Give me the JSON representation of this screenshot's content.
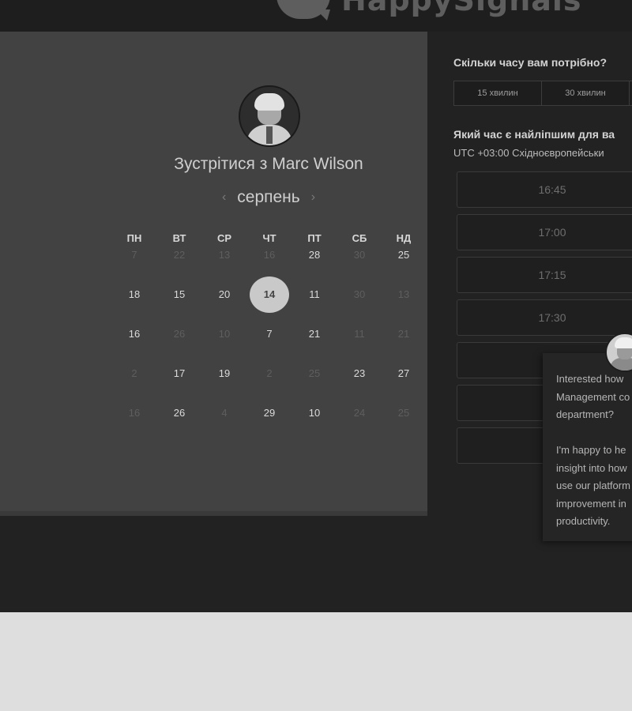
{
  "header": {
    "logo_text": "HappySignals"
  },
  "scheduler": {
    "title": "Зустрітися з Marc Wilson",
    "month": "серпень",
    "prev_label": "‹",
    "next_label": "›",
    "weekdays": [
      "ПН",
      "ВТ",
      "СР",
      "ЧТ",
      "ПТ",
      "СБ",
      "НД"
    ],
    "weeks": [
      [
        {
          "d": "7",
          "a": false
        },
        {
          "d": "22",
          "a": false
        },
        {
          "d": "13",
          "a": false
        },
        {
          "d": "16",
          "a": false
        },
        {
          "d": "28",
          "a": true
        },
        {
          "d": "30",
          "a": false
        },
        {
          "d": "25",
          "a": true
        }
      ],
      [
        {
          "d": "18",
          "a": true
        },
        {
          "d": "15",
          "a": true
        },
        {
          "d": "20",
          "a": true
        },
        {
          "d": "14",
          "a": true,
          "selected": true
        },
        {
          "d": "11",
          "a": true
        },
        {
          "d": "30",
          "a": false
        },
        {
          "d": "13",
          "a": false
        }
      ],
      [
        {
          "d": "16",
          "a": true
        },
        {
          "d": "26",
          "a": false
        },
        {
          "d": "10",
          "a": false
        },
        {
          "d": "7",
          "a": true
        },
        {
          "d": "21",
          "a": true
        },
        {
          "d": "11",
          "a": false
        },
        {
          "d": "21",
          "a": false
        }
      ],
      [
        {
          "d": "2",
          "a": false
        },
        {
          "d": "17",
          "a": true
        },
        {
          "d": "19",
          "a": true
        },
        {
          "d": "2",
          "a": false
        },
        {
          "d": "25",
          "a": false
        },
        {
          "d": "23",
          "a": true
        },
        {
          "d": "27",
          "a": true
        }
      ],
      [
        {
          "d": "16",
          "a": false
        },
        {
          "d": "26",
          "a": true
        },
        {
          "d": "4",
          "a": false
        },
        {
          "d": "29",
          "a": true
        },
        {
          "d": "10",
          "a": true
        },
        {
          "d": "24",
          "a": false
        },
        {
          "d": "25",
          "a": false
        }
      ]
    ]
  },
  "booking": {
    "duration_question": "Скільки часу вам потрібно?",
    "durations": [
      "15 хвилин",
      "30 хвилин"
    ],
    "time_question": "Який час є найліпшим для ва",
    "timezone": "UTC +03:00 Східноєвропейськи",
    "slots": [
      "16:45",
      "17:00",
      "17:15",
      "17:30",
      "",
      "",
      ""
    ]
  },
  "chat": {
    "message": "Interested how\nManagement co\ndepartment?\n\nI'm happy to he\ninsight into how\nuse our platform\nimprovement in\nproductivity."
  }
}
